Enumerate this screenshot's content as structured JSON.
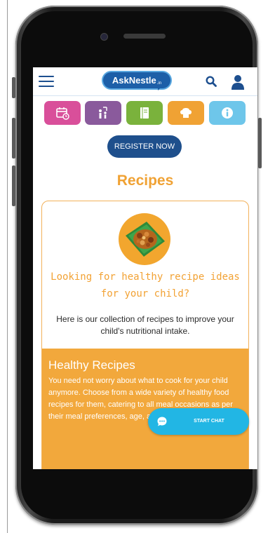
{
  "header": {
    "logo_text": "AskNestle",
    "logo_suffix": ".in",
    "menu_icon": "hamburger-menu-icon",
    "search_icon": "search-icon",
    "profile_icon": "user-icon"
  },
  "categories": [
    {
      "icon": "calendar-icon",
      "color": "#d94f9a"
    },
    {
      "icon": "growth-chart-icon",
      "color": "#8a5a9c"
    },
    {
      "icon": "notebook-icon",
      "color": "#7ab23c"
    },
    {
      "icon": "chef-hat-icon",
      "color": "#f0a234"
    },
    {
      "icon": "info-icon",
      "color": "#6ec6ea"
    }
  ],
  "register": {
    "label": "REGISTER NOW"
  },
  "page": {
    "title": "Recipes"
  },
  "intro": {
    "heading": "Looking for healthy recipe ideas for your child?",
    "text": "Here is our collection of recipes to improve your child's nutritional intake."
  },
  "healthy_recipes": {
    "title": "Healthy Recipes",
    "text": "You need not worry about what to cook for your child anymore. Choose from a wide variety of healthy food recipes for them, catering to all meal occasions as per their meal preferences, age, and food"
  },
  "chat": {
    "label": "START CHAT"
  },
  "colors": {
    "primary_blue": "#1e4f8c",
    "accent_orange": "#f0a234",
    "chat_blue": "#22b6e4"
  }
}
